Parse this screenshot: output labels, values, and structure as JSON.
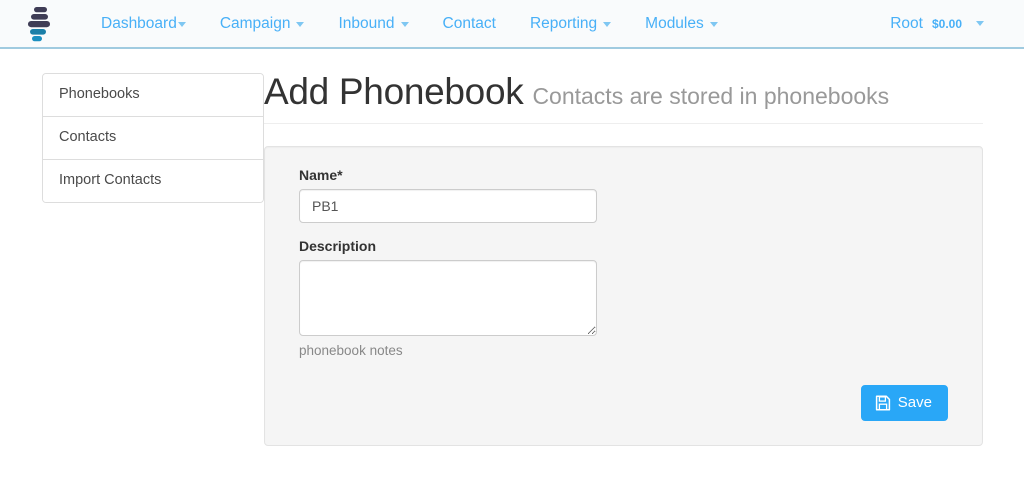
{
  "navbar": {
    "brand_icon": "stacked-bars-logo",
    "links": [
      {
        "label": "Dashboard",
        "has_caret": true,
        "caret_tight": true
      },
      {
        "label": "Campaign",
        "has_caret": true,
        "caret_tight": false
      },
      {
        "label": "Inbound",
        "has_caret": true,
        "caret_tight": false
      },
      {
        "label": "Contact",
        "has_caret": false,
        "caret_tight": false
      },
      {
        "label": "Reporting",
        "has_caret": true,
        "caret_tight": false
      },
      {
        "label": "Modules",
        "has_caret": true,
        "caret_tight": false
      }
    ],
    "user": {
      "name": "Root",
      "balance": "$0.00",
      "caret_icon": "chevron-down-icon"
    },
    "border_color": "#a0cbe0",
    "link_color": "#48b0f7"
  },
  "sidebar": {
    "items": [
      {
        "label": "Phonebooks"
      },
      {
        "label": "Contacts"
      },
      {
        "label": "Import Contacts"
      }
    ]
  },
  "header": {
    "title": "Add Phonebook",
    "subtitle": "Contacts are stored in phonebooks"
  },
  "form": {
    "name_field": {
      "label": "Name*",
      "value": "PB1",
      "placeholder": ""
    },
    "description_field": {
      "label": "Description",
      "value": "",
      "placeholder": "",
      "help_text": "phonebook notes"
    },
    "save_button": {
      "label": "Save",
      "icon": "floppy-disk-save-icon",
      "color": "#29a7f7"
    }
  }
}
